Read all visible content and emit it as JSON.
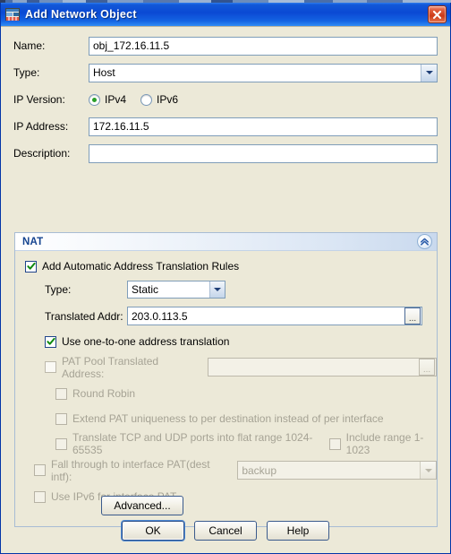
{
  "window": {
    "title": "Add Network Object",
    "icon": "network-object-icon",
    "close_label": "✕",
    "accent_color": "#0a49d4",
    "client_bg": "#ece9d8"
  },
  "form": {
    "fields": [
      {
        "label": "Name:",
        "value": "obj_172.16.11.5",
        "type": "text"
      },
      {
        "label": "Type:",
        "value": "Host",
        "type": "combo"
      },
      {
        "label": "IP Version:",
        "type": "radio"
      },
      {
        "label": "IP Address:",
        "value": "172.16.11.5",
        "type": "text"
      },
      {
        "label": "Description:",
        "value": "",
        "type": "text"
      }
    ],
    "ip_version": {
      "label": "IP Version:",
      "options": [
        {
          "label": "IPv4",
          "selected": true
        },
        {
          "label": "IPv6",
          "selected": false
        }
      ],
      "selected_color": "#2aa02a"
    }
  },
  "nat": {
    "title": "NAT",
    "collapse_icon": "chevron-double-up-icon",
    "title_color": "#15448f",
    "auto_rules": {
      "label": "Add Automatic Address Translation Rules",
      "checked": true
    },
    "type": {
      "label": "Type:",
      "value": "Static"
    },
    "translated_addr": {
      "label": "Translated Addr:",
      "value": "203.0.113.5",
      "browse_label": "..."
    },
    "one_to_one": {
      "label": "Use one-to-one address translation",
      "checked": true
    },
    "pat_pool": {
      "label": "PAT Pool Translated Address:",
      "value": "",
      "checked": false,
      "enabled": false,
      "browse_label": "..."
    },
    "round_robin": {
      "label": "Round Robin",
      "checked": false,
      "enabled": false
    },
    "extend_pat": {
      "label": "Extend PAT uniqueness to per destination instead of per interface",
      "checked": false,
      "enabled": false
    },
    "flat_range": {
      "label": "Translate TCP and UDP ports into flat range 1024-65535",
      "checked": false,
      "enabled": false
    },
    "include_range": {
      "label": "Include range 1-1023",
      "checked": false,
      "enabled": false
    },
    "fall_through": {
      "label": "Fall through to interface PAT(dest intf):",
      "checked": false,
      "enabled": false,
      "value": "backup"
    },
    "use_ipv6": {
      "label": "Use IPv6 for interface PAT",
      "checked": false,
      "enabled": false
    },
    "advanced_label": "Advanced..."
  },
  "footer": {
    "ok_label": "OK",
    "cancel_label": "Cancel",
    "help_label": "Help"
  }
}
